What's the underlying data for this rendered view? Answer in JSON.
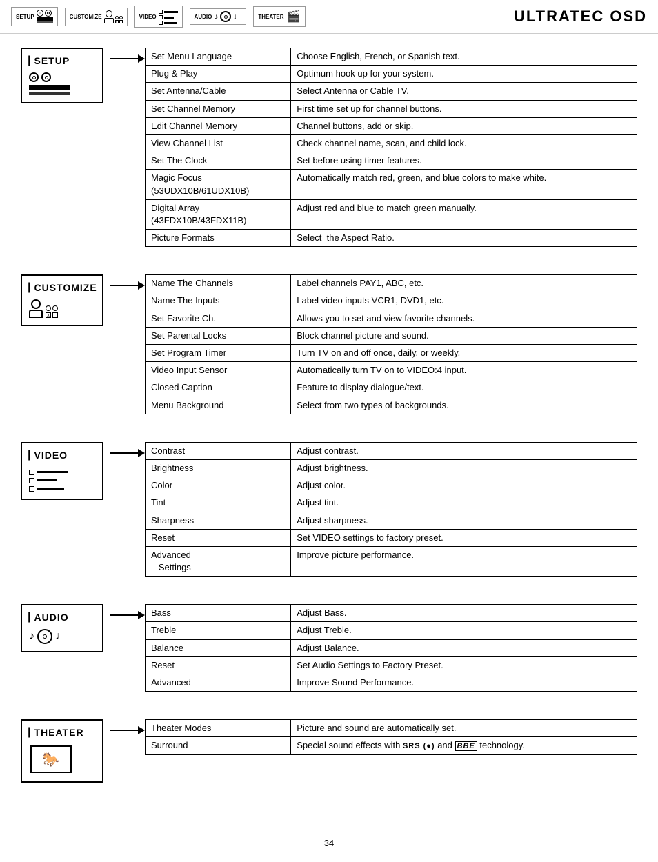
{
  "header": {
    "title": "ULTRATEC OSD",
    "icons": [
      {
        "label": "SETUP"
      },
      {
        "label": "CUSTOMIZE"
      },
      {
        "label": "VIDEO"
      },
      {
        "label": "AUDIO"
      },
      {
        "label": "THEATER"
      }
    ]
  },
  "sections": {
    "setup": {
      "label": "SETUP",
      "menu_items": [
        {
          "name": "Set Menu Language",
          "desc": "Choose English, French, or Spanish text."
        },
        {
          "name": "Plug & Play",
          "desc": "Optimum hook up for your system."
        },
        {
          "name": "Set Antenna/Cable",
          "desc": "Select Antenna or Cable TV."
        },
        {
          "name": "Set Channel Memory",
          "desc": "First time set up for channel buttons."
        },
        {
          "name": "Edit Channel Memory",
          "desc": "Channel buttons, add or skip."
        },
        {
          "name": "View Channel List",
          "desc": "Check channel name, scan, and child lock."
        },
        {
          "name": "Set The Clock",
          "desc": "Set before using timer features."
        },
        {
          "name": "Magic Focus\n(53UDX10B/61UDX10B)",
          "desc": "Automatically match red, green, and blue colors to make white."
        },
        {
          "name": "Digital Array\n(43FDX10B/43FDX11B)",
          "desc": "Adjust red and blue to match green manually."
        },
        {
          "name": "Picture Formats",
          "desc": "Select  the Aspect Ratio."
        }
      ]
    },
    "customize": {
      "label": "CUSTOMIZE",
      "menu_items": [
        {
          "name": "Name The Channels",
          "desc": "Label channels PAY1, ABC, etc."
        },
        {
          "name": "Name The Inputs",
          "desc": "Label video inputs VCR1, DVD1, etc."
        },
        {
          "name": "Set Favorite Ch.",
          "desc": "Allows you to set and view favorite channels."
        },
        {
          "name": "Set Parental Locks",
          "desc": "Block channel picture and sound."
        },
        {
          "name": "Set Program Timer",
          "desc": "Turn TV on and off once, daily, or weekly."
        },
        {
          "name": "Video Input Sensor",
          "desc": "Automatically turn TV on to VIDEO:4 input."
        },
        {
          "name": "Closed Caption",
          "desc": "Feature to display dialogue/text."
        },
        {
          "name": "Menu Background",
          "desc": "Select from two types of backgrounds."
        }
      ]
    },
    "video": {
      "label": "VIDEO",
      "menu_items": [
        {
          "name": "Contrast",
          "desc": "Adjust contrast."
        },
        {
          "name": "Brightness",
          "desc": "Adjust brightness."
        },
        {
          "name": "Color",
          "desc": "Adjust color."
        },
        {
          "name": "Tint",
          "desc": "Adjust tint."
        },
        {
          "name": "Sharpness",
          "desc": "Adjust sharpness."
        },
        {
          "name": "Reset",
          "desc": "Set VIDEO settings to factory preset."
        },
        {
          "name": "Advanced\n   Settings",
          "desc": "Improve picture performance."
        }
      ]
    },
    "audio": {
      "label": "AUDIO",
      "menu_items": [
        {
          "name": "Bass",
          "desc": "Adjust Bass."
        },
        {
          "name": "Treble",
          "desc": "Adjust Treble."
        },
        {
          "name": "Balance",
          "desc": "Adjust Balance."
        },
        {
          "name": "Reset",
          "desc": "Set Audio Settings to Factory Preset."
        },
        {
          "name": "Advanced",
          "desc": "Improve Sound Performance."
        }
      ]
    },
    "theater": {
      "label": "THEATER",
      "menu_items": [
        {
          "name": "Theater Modes",
          "desc": "Picture and sound are automatically set."
        },
        {
          "name": "Surround",
          "desc": "Special sound effects with SRS (●) and BBE technology."
        }
      ]
    }
  },
  "footer": {
    "page_number": "34"
  }
}
